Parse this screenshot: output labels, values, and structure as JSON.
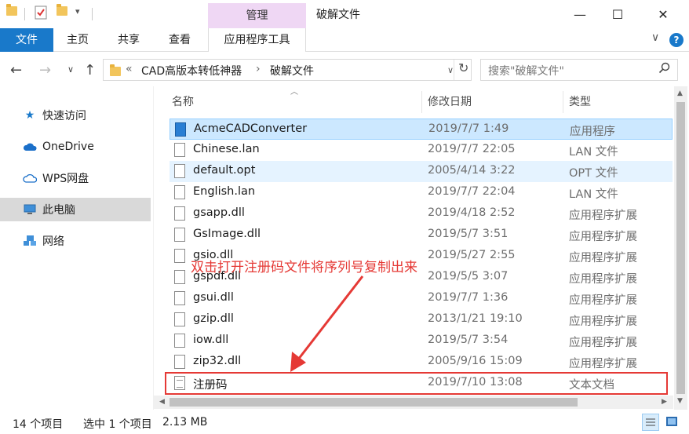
{
  "window": {
    "title": "破解文件",
    "manage_tab": "管理",
    "minimize": "—",
    "maximize": "☐",
    "close": "✕"
  },
  "ribbon": {
    "file_tab": "文件",
    "tabs": [
      "主页",
      "共享",
      "查看"
    ],
    "app_tools_tab": "应用程序工具",
    "help": "?",
    "collapse": "∨"
  },
  "address": {
    "breadcrumbs": [
      "«",
      "CAD高版本转低神器",
      "›",
      "破解文件"
    ],
    "back": "←",
    "forward": "→",
    "recent": "∨",
    "up": "↑",
    "dropdown": "∨",
    "refresh": "↻"
  },
  "search": {
    "placeholder": "搜索\"破解文件\"",
    "icon": "search-icon"
  },
  "nav": {
    "items": [
      {
        "label": "快速访问",
        "icon": "star-icon"
      },
      {
        "label": "OneDrive",
        "icon": "cloud-icon"
      },
      {
        "label": "WPS网盘",
        "icon": "cloud-outline-icon"
      },
      {
        "label": "此电脑",
        "icon": "computer-icon"
      },
      {
        "label": "网络",
        "icon": "network-icon"
      }
    ],
    "selected": "此电脑"
  },
  "columns": {
    "name": "名称",
    "date": "修改日期",
    "type": "类型"
  },
  "files": [
    {
      "name": "AcmeCADConverter",
      "date": "2019/7/7 1:49",
      "type": "应用程序",
      "icon": "exe"
    },
    {
      "name": "Chinese.lan",
      "date": "2019/7/7 22:05",
      "type": "LAN 文件",
      "icon": "file"
    },
    {
      "name": "default.opt",
      "date": "2005/4/14 3:22",
      "type": "OPT 文件",
      "icon": "file"
    },
    {
      "name": "English.lan",
      "date": "2019/7/7 22:04",
      "type": "LAN 文件",
      "icon": "file"
    },
    {
      "name": "gsapp.dll",
      "date": "2019/4/18 2:52",
      "type": "应用程序扩展",
      "icon": "dll"
    },
    {
      "name": "GsImage.dll",
      "date": "2019/5/7 3:51",
      "type": "应用程序扩展",
      "icon": "dll"
    },
    {
      "name": "gsio.dll",
      "date": "2019/5/27 2:55",
      "type": "应用程序扩展",
      "icon": "dll"
    },
    {
      "name": "gspdf.dll",
      "date": "2019/5/5 3:07",
      "type": "应用程序扩展",
      "icon": "dll"
    },
    {
      "name": "gsui.dll",
      "date": "2019/7/7 1:36",
      "type": "应用程序扩展",
      "icon": "dll"
    },
    {
      "name": "gzip.dll",
      "date": "2013/1/21 19:10",
      "type": "应用程序扩展",
      "icon": "dll"
    },
    {
      "name": "iow.dll",
      "date": "2019/5/7 3:54",
      "type": "应用程序扩展",
      "icon": "dll"
    },
    {
      "name": "zip32.dll",
      "date": "2005/9/16 15:09",
      "type": "应用程序扩展",
      "icon": "dll"
    },
    {
      "name": "注册码",
      "date": "2019/7/10 13:08",
      "type": "文本文档",
      "icon": "txt"
    }
  ],
  "annotation": "双击打开注册码文件将序列号复制出来",
  "status": {
    "count": "14 个项目",
    "selection": "选中 1 个项目",
    "size": "2.13 MB"
  },
  "colors": {
    "accent": "#1979ca",
    "manage_tab_bg": "#efd7f4",
    "selection_bg": "#cce8ff",
    "annotation": "#e53935"
  }
}
